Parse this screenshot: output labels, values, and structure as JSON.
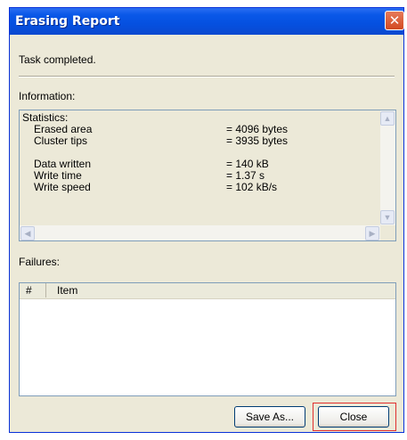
{
  "window": {
    "title": "Erasing Report",
    "close_glyph": "✕"
  },
  "status_text": "Task completed.",
  "information": {
    "label": "Information:",
    "heading": "Statistics:",
    "group1": [
      {
        "key": "Erased area",
        "value": "= 4096 bytes"
      },
      {
        "key": "Cluster tips",
        "value": "= 3935 bytes"
      }
    ],
    "group2": [
      {
        "key": "Data written",
        "value": "= 140 kB"
      },
      {
        "key": "Write time",
        "value": "= 1.37 s"
      },
      {
        "key": "Write speed",
        "value": "= 102 kB/s"
      }
    ]
  },
  "failures": {
    "label": "Failures:",
    "columns": [
      "#",
      "Item"
    ],
    "rows": []
  },
  "buttons": {
    "save_as": "Save As...",
    "close": "Close"
  },
  "icons": {
    "scroll_up": "chevron-up-icon",
    "scroll_down": "chevron-down-icon",
    "scroll_left": "chevron-left-icon",
    "scroll_right": "chevron-right-icon"
  }
}
